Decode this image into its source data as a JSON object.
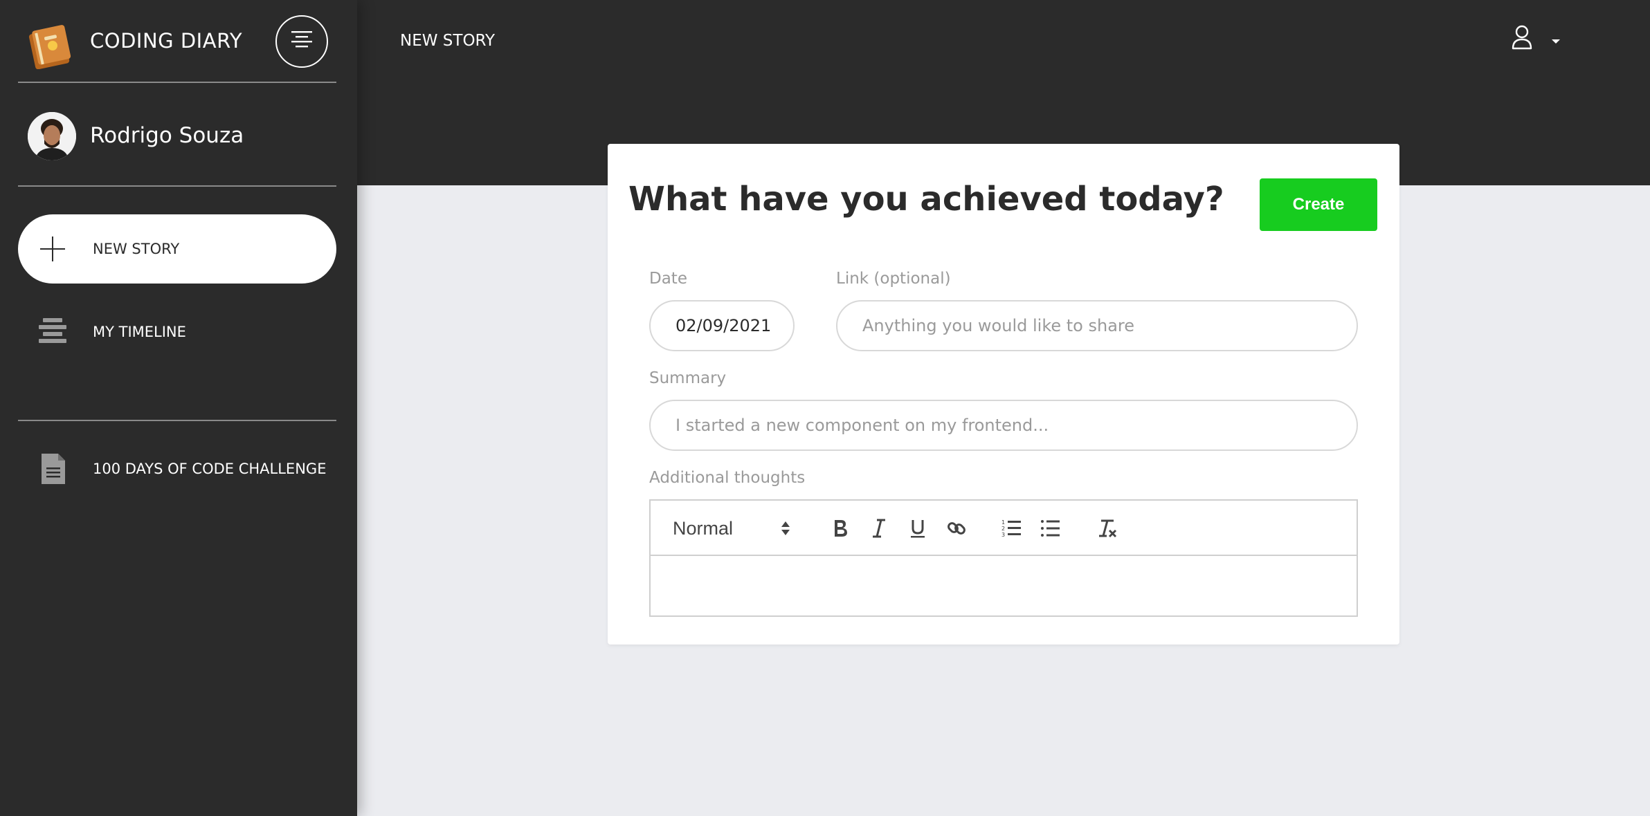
{
  "app": {
    "title": "CODING DIARY"
  },
  "user": {
    "name": "Rodrigo Souza"
  },
  "sidebar": {
    "items": [
      {
        "label": "NEW STORY",
        "icon": "plus-icon"
      },
      {
        "label": "MY TIMELINE",
        "icon": "timeline-icon"
      },
      {
        "label": "100 DAYS OF CODE CHALLENGE",
        "icon": "document-icon"
      }
    ]
  },
  "header": {
    "title": "NEW STORY"
  },
  "form": {
    "heading": "What have you achieved today?",
    "create_label": "Create",
    "date_label": "Date",
    "date_value": "02/09/2021",
    "link_label": "Link (optional)",
    "link_placeholder": "Anything you would like to share",
    "summary_label": "Summary",
    "summary_placeholder": "I started a new component on my frontend...",
    "thoughts_label": "Additional thoughts"
  },
  "editor": {
    "heading_value": "Normal",
    "tools": [
      "bold-icon",
      "italic-icon",
      "underline-icon",
      "link-icon",
      "ordered-list-icon",
      "bullet-list-icon",
      "clear-format-icon"
    ]
  },
  "colors": {
    "accent": "#17cc1f",
    "dark": "#2b2b2b",
    "background": "#ebecf0"
  }
}
